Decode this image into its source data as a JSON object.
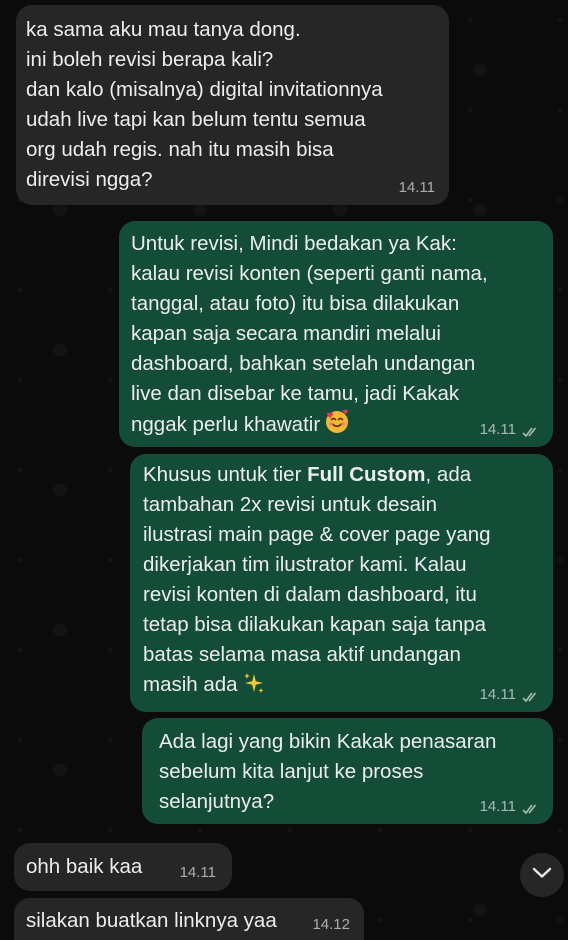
{
  "messages": [
    {
      "id": "m1",
      "direction": "incoming",
      "text": "ka sama aku mau tanya dong.\nini boleh revisi berapa kali?\ndan kalo (misalnya) digital invitationnya\nudah live tapi kan belum tentu semua\norg udah regis. nah itu masih bisa\ndirevisi ngga?",
      "time": "14.11"
    },
    {
      "id": "m2",
      "direction": "outgoing",
      "text": "Untuk revisi, Mindi bedakan ya Kak:\nkalau revisi konten (seperti ganti nama,\ntanggal, atau foto) itu bisa dilakukan\nkapan saja secara mandiri melalui\ndashboard, bahkan setelah undangan\nlive dan disebar ke tamu, jadi Kakak\nnggak perlu khawatir",
      "emoji": "smiling-face-with-hearts",
      "time": "14.11",
      "status": "read"
    },
    {
      "id": "m3",
      "direction": "outgoing",
      "text_before_bold": "Khusus untuk tier ",
      "bold": "Full Custom",
      "text_after_bold": ", ada\ntambahan 2x revisi untuk desain\nilustrasi main page & cover page yang\ndikerjakan tim ilustrator kami. Kalau\nrevisi konten di dalam dashboard, itu\ntetap bisa dilakukan kapan saja tanpa\nbatas selama masa aktif undangan\nmasih ada",
      "emoji": "sparkles",
      "time": "14.11",
      "status": "read"
    },
    {
      "id": "m4",
      "direction": "outgoing",
      "text": "Ada lagi yang bikin Kakak penasaran\nsebelum kita lanjut ke proses\nselanjutnya?",
      "time": "14.11",
      "status": "read"
    },
    {
      "id": "m5",
      "direction": "incoming",
      "text": "ohh baik kaa",
      "time": "14.11"
    },
    {
      "id": "m6",
      "direction": "incoming",
      "text": "silakan buatkan linknya yaa",
      "time": "14.12"
    }
  ],
  "colors": {
    "background": "#0b0b0b",
    "incoming_bubble": "#262626",
    "outgoing_bubble": "#144d37",
    "read_ticks": "#a8bfb4"
  },
  "icons": {
    "read_receipt": "double-check-icon",
    "scroll_down": "chevron-down-icon"
  }
}
